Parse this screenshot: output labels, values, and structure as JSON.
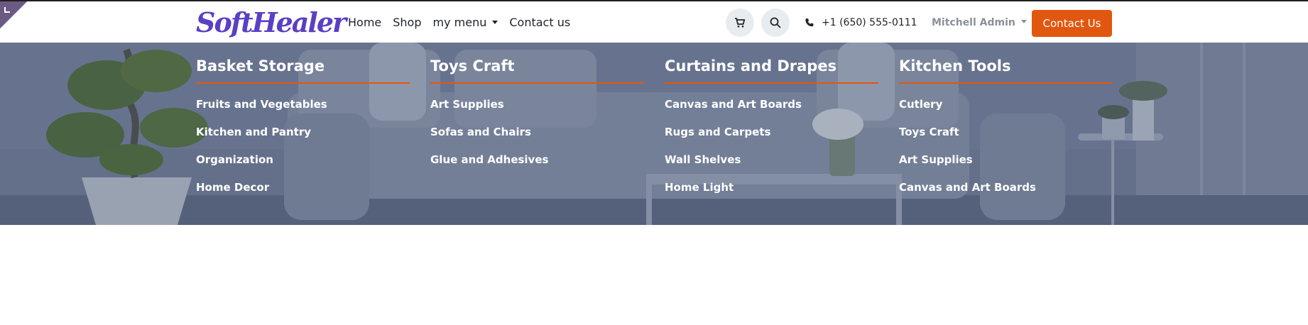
{
  "brand": {
    "logo_text": "SoftHealer",
    "logo_color": "#5b3fc4"
  },
  "nav": {
    "links": [
      {
        "label": "Home"
      },
      {
        "label": "Shop"
      },
      {
        "label": "my menu"
      },
      {
        "label": "Contact us"
      }
    ]
  },
  "header": {
    "cart_icon": "shopping-cart-icon",
    "search_icon": "search-icon",
    "phone_icon": "phone-icon",
    "phone": "+1 (650) 555-0111",
    "user": "Mitchell Admin",
    "cta_label": "Contact Us",
    "cta_color": "#e2570f"
  },
  "mega_menu": {
    "columns": [
      {
        "title": "Basket Storage",
        "items": [
          "Fruits and Vegetables",
          "Kitchen and Pantry",
          "Organization",
          "Home Decor"
        ]
      },
      {
        "title": "Toys Craft",
        "items": [
          "Art Supplies",
          "Sofas and Chairs",
          "Glue and Adhesives"
        ]
      },
      {
        "title": "Curtains and Drapes",
        "items": [
          "Canvas and Art Boards",
          "Rugs and Carpets",
          "Wall Shelves",
          "Home Light"
        ]
      },
      {
        "title": "Kitchen Tools",
        "items": [
          "Cutlery",
          "Toys Craft",
          "Art Supplies",
          "Canvas and Art Boards"
        ]
      }
    ],
    "accent": "#e2570f"
  }
}
